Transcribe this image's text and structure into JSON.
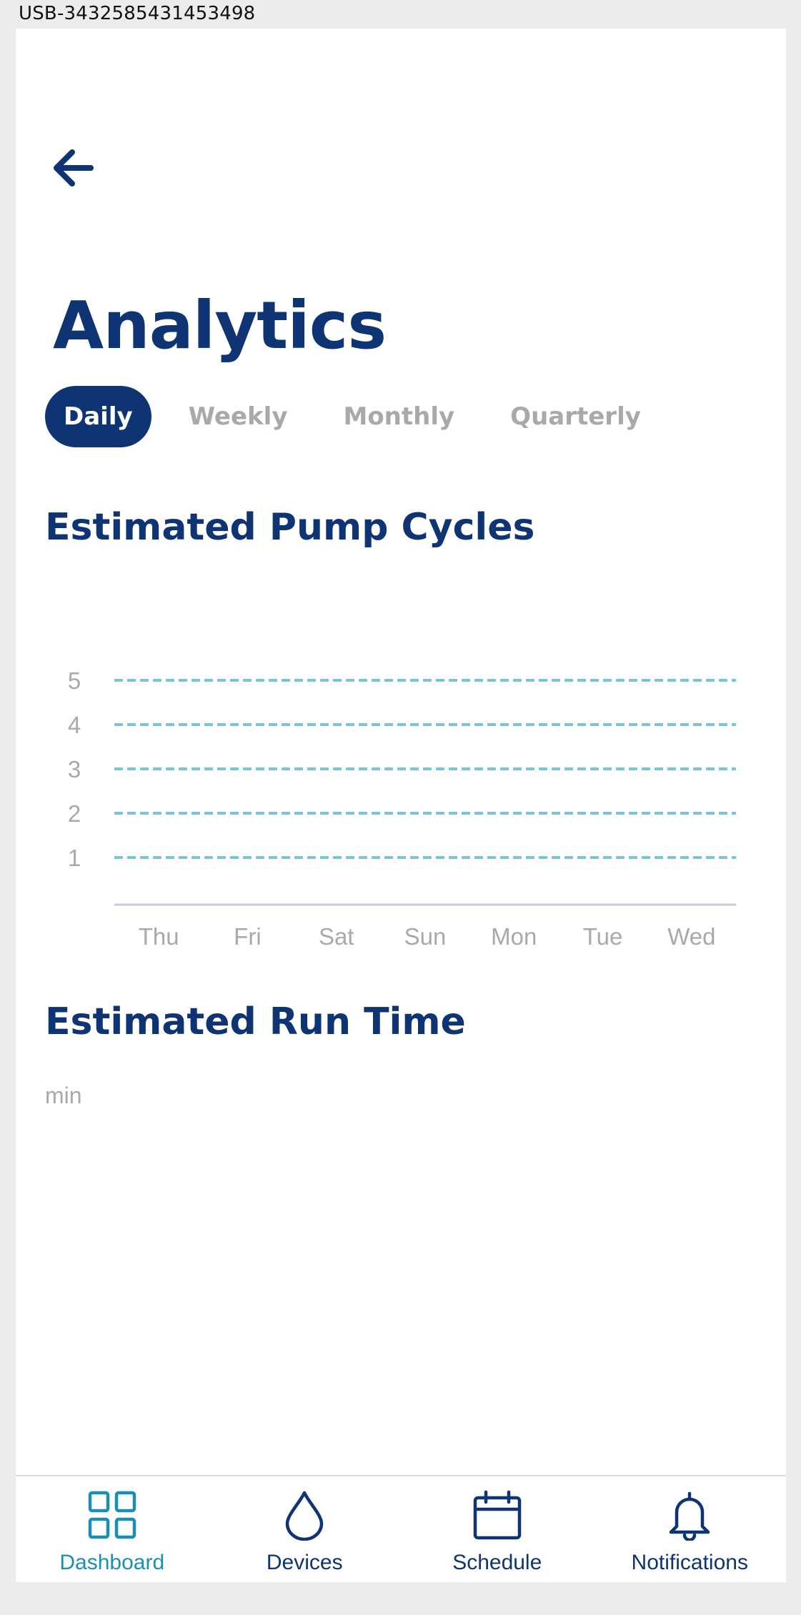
{
  "window": {
    "title": "USB-3432585431453498"
  },
  "header": {
    "back_icon": "arrow-left-icon",
    "title": "Analytics"
  },
  "tabs": [
    {
      "label": "Daily",
      "active": true
    },
    {
      "label": "Weekly",
      "active": false
    },
    {
      "label": "Monthly",
      "active": false
    },
    {
      "label": "Quarterly",
      "active": false
    }
  ],
  "sections": {
    "pump_cycles": {
      "title": "Estimated Pump Cycles"
    },
    "run_time": {
      "title": "Estimated Run Time",
      "unit": "min"
    }
  },
  "chart_data": {
    "type": "line",
    "title": "Estimated Pump Cycles",
    "categories": [
      "Thu",
      "Fri",
      "Sat",
      "Sun",
      "Mon",
      "Tue",
      "Wed"
    ],
    "y_ticks": [
      "1",
      "2",
      "3",
      "4",
      "5"
    ],
    "ylim": [
      0,
      5
    ],
    "grid": true,
    "grid_style": "dashed",
    "series": [],
    "colors": {
      "grid": "#7cc3d6",
      "axis": "#c9ccd6",
      "tick_text": "#a9a9a9"
    }
  },
  "bottom_nav": [
    {
      "label": "Dashboard",
      "icon": "grid-icon",
      "active": true
    },
    {
      "label": "Devices",
      "icon": "water-drop-icon",
      "active": false
    },
    {
      "label": "Schedule",
      "icon": "calendar-icon",
      "active": false
    },
    {
      "label": "Notifications",
      "icon": "bell-icon",
      "active": false
    }
  ],
  "colors": {
    "primary": "#0f3473",
    "accent": "#1a8fb4",
    "muted": "#a9a9a9"
  }
}
